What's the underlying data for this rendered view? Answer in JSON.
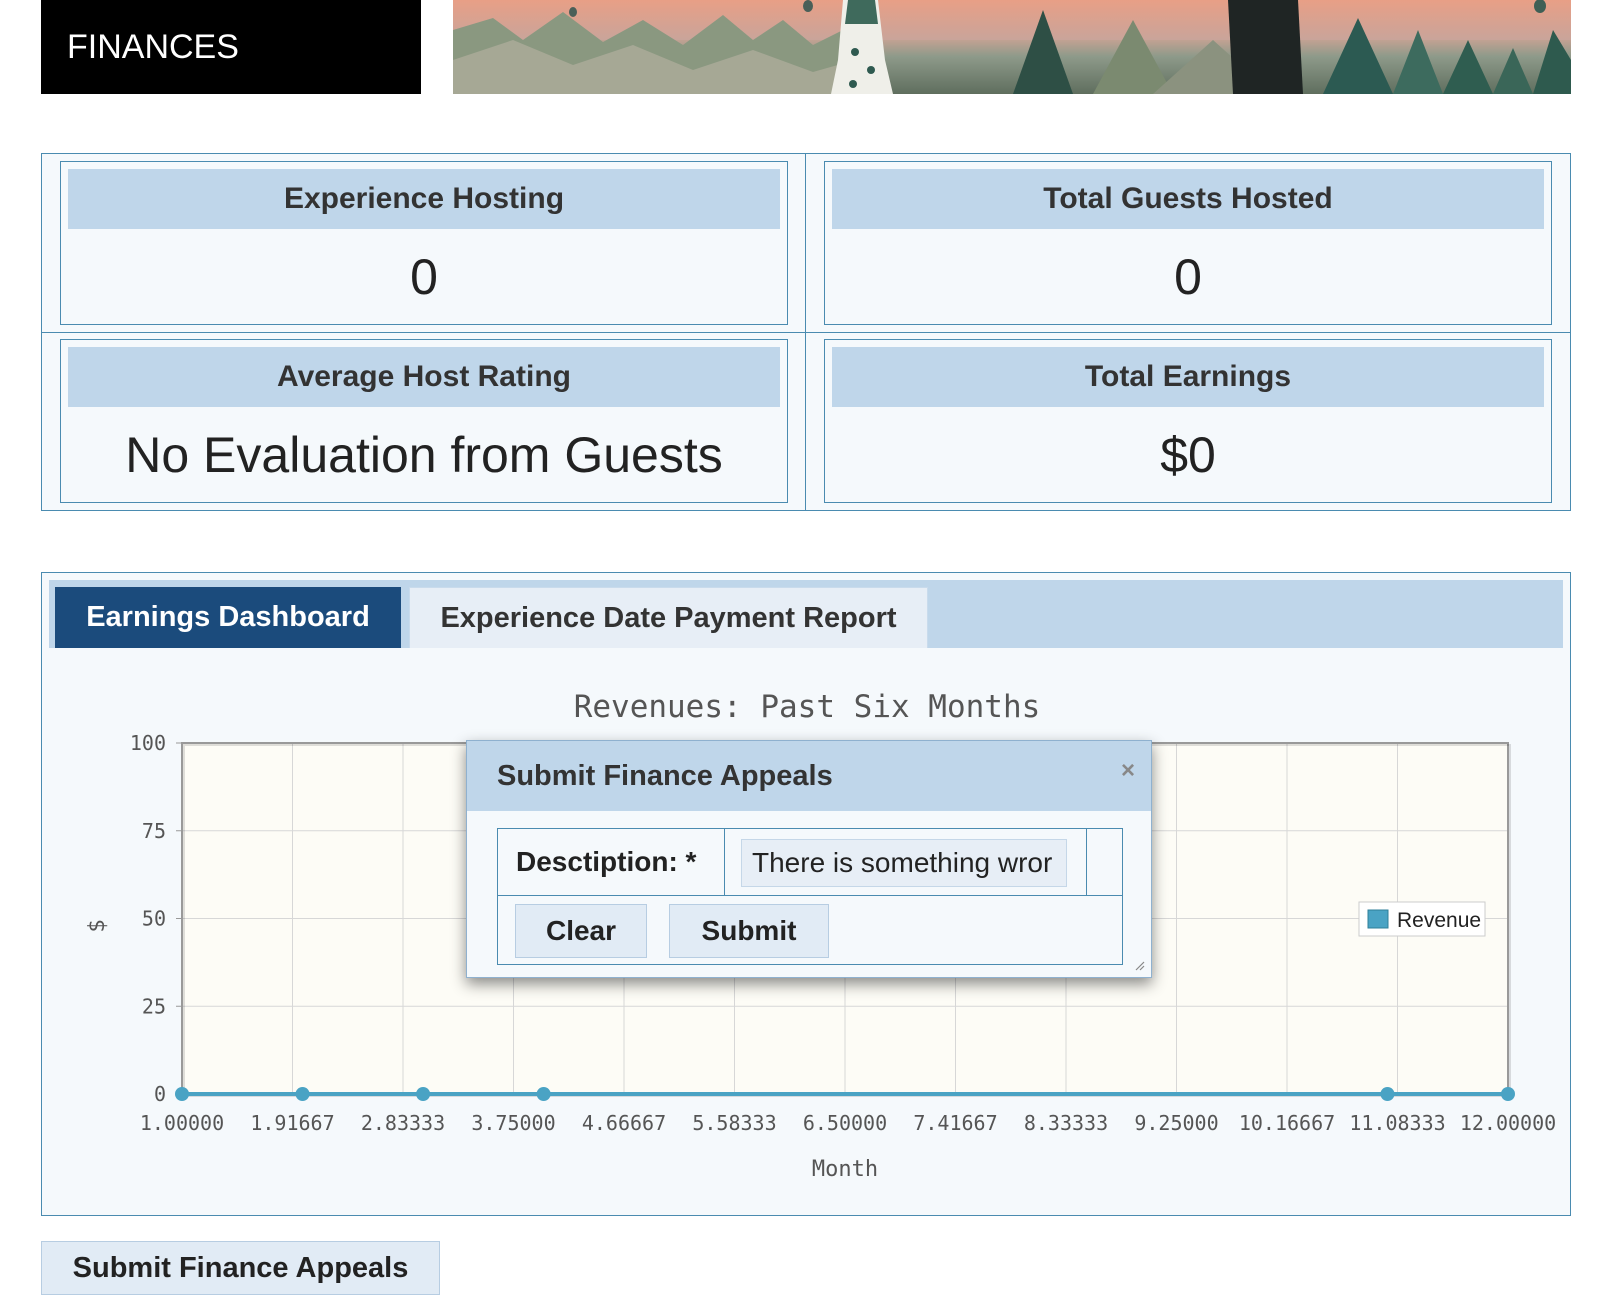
{
  "header": {
    "title": "FINANCES"
  },
  "stats": [
    {
      "label": "Experience Hosting",
      "value": "0"
    },
    {
      "label": "Total Guests Hosted",
      "value": "0"
    },
    {
      "label": "Average Host Rating",
      "value": "No Evaluation from Guests"
    },
    {
      "label": "Total Earnings",
      "value": "$0"
    }
  ],
  "tabs": [
    {
      "label": "Earnings Dashboard",
      "active": true
    },
    {
      "label": "Experience Date Payment Report",
      "active": false
    }
  ],
  "chart_data": {
    "type": "line",
    "title": "Revenues: Past Six Months",
    "xlabel": "Month",
    "ylabel": "$",
    "xlim": [
      1,
      12
    ],
    "ylim": [
      0,
      100
    ],
    "y_ticks": [
      "0",
      "25",
      "50",
      "75",
      "100"
    ],
    "x_ticks": [
      "1.00000",
      "1.91667",
      "2.83333",
      "3.75000",
      "4.66667",
      "5.58333",
      "6.50000",
      "7.41667",
      "8.33333",
      "9.25000",
      "10.16667",
      "11.08333",
      "12.00000"
    ],
    "grid": true,
    "legend_position": "right",
    "series": [
      {
        "name": "Revenue",
        "color": "#4aa3c4",
        "points": [
          [
            1,
            0
          ],
          [
            2,
            0
          ],
          [
            3,
            0
          ],
          [
            4,
            0
          ],
          [
            11,
            0
          ],
          [
            12,
            0
          ]
        ]
      }
    ]
  },
  "modal": {
    "title": "Submit Finance Appeals",
    "close_icon": "×",
    "description_label": "Desctiption: *",
    "description_value": "There is something wror",
    "clear_label": "Clear",
    "submit_label": "Submit"
  },
  "appeals_button": {
    "label": "Submit Finance Appeals"
  }
}
